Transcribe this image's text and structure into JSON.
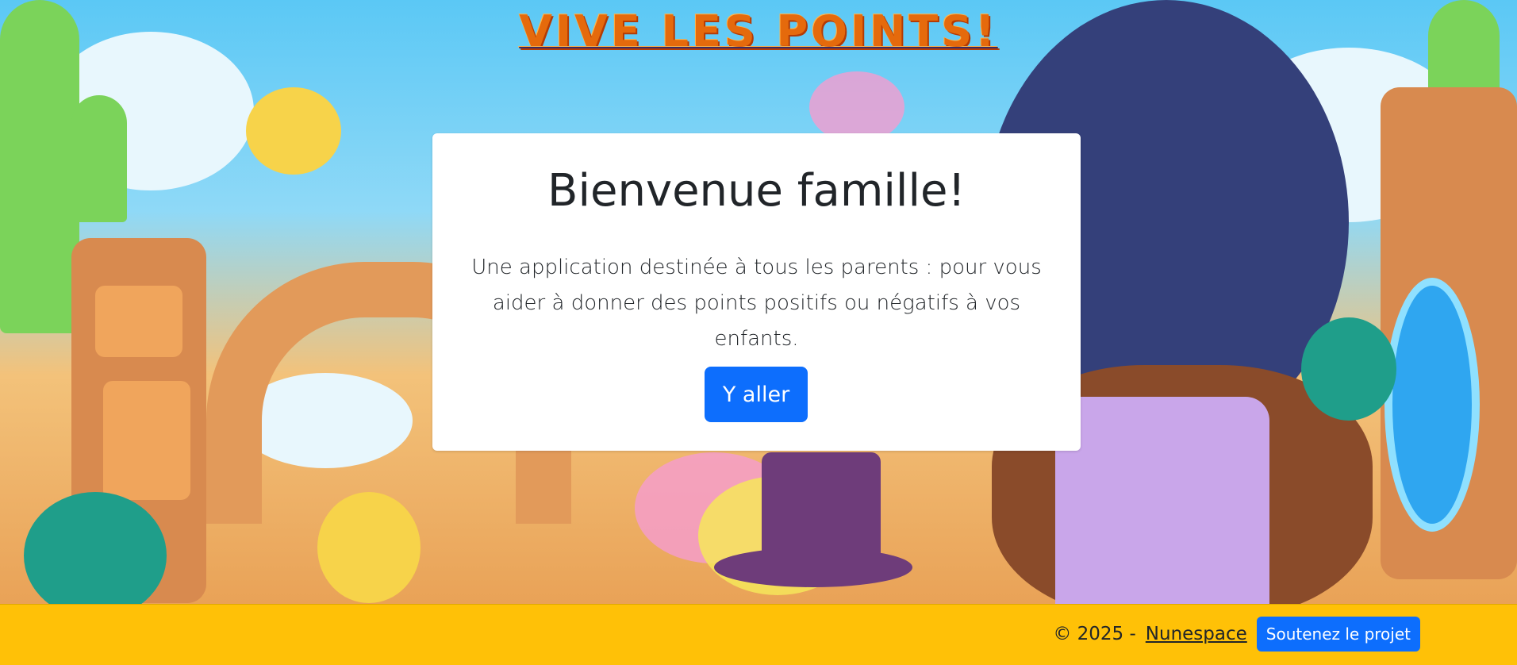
{
  "header": {
    "title": "VIVE LES POINTS!"
  },
  "card": {
    "heading": "Bienvenue famille!",
    "description": "Une application destinée à tous les parents : pour vous aider à donner des points positifs ou négatifs à vos enfants.",
    "cta_label": "Y aller"
  },
  "footer": {
    "copyright": "© 2025 -",
    "link_label": "Nunespace",
    "support_label": "Soutenez le projet"
  },
  "colors": {
    "primary": "#0d6efd",
    "footer_bg": "#ffc107",
    "title": "#e56a0c"
  }
}
